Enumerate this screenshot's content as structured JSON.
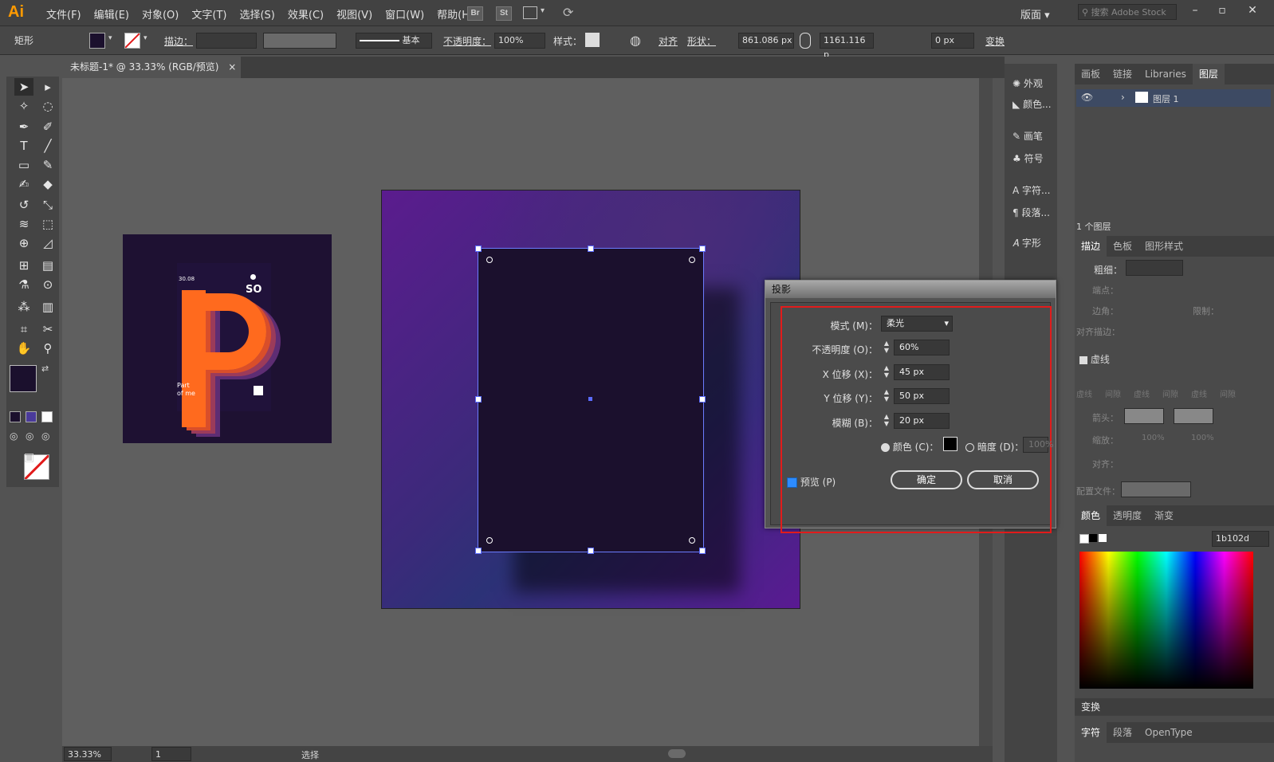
{
  "app": {
    "logo": "Ai"
  },
  "menu": [
    "文件(F)",
    "编辑(E)",
    "对象(O)",
    "文字(T)",
    "选择(S)",
    "效果(C)",
    "视图(V)",
    "窗口(W)",
    "帮助(H)"
  ],
  "bridge_labels": {
    "br": "Br",
    "st": "St"
  },
  "workspace": {
    "label": "版面",
    "search_placeholder": "搜索 Adobe Stock"
  },
  "control_bar": {
    "object_type": "矩形",
    "stroke_label": "描边：",
    "stroke_style": "基本",
    "opacity_label": "不透明度：",
    "opacity_value": "100%",
    "style_label": "样式：",
    "align_label": "对齐",
    "shape_label": "形状：",
    "width_value": "861.086 px",
    "height_value": "1161.116 p",
    "corner_value": "0 px",
    "transform_label": "变换"
  },
  "document": {
    "tab_title": "未标题-1* @ 33.33% (RGB/预览)",
    "close": "×"
  },
  "status": {
    "zoom": "33.33%",
    "page": "1",
    "mode": "选择"
  },
  "poster": {
    "date": "30.08",
    "so": "SO",
    "caption": "Part\nof me"
  },
  "mid_panel": [
    "外观",
    "颜色...",
    "画笔",
    "符号",
    "字符...",
    "段落...",
    "字形"
  ],
  "layers_panel": {
    "tabs": [
      "画板",
      "链接",
      "Libraries",
      "图层"
    ],
    "active_tab": "图层",
    "layer_name": "图层 1",
    "count": "1 个图层"
  },
  "stroke_panel": {
    "tabs": [
      "描边",
      "色板",
      "图形样式"
    ],
    "weight_label": "粗细：",
    "cap_label": "端点：",
    "corner_label": "边角：",
    "limit_label": "限制：",
    "align_label": "对齐描边：",
    "dashed_label": "虚线",
    "dash_gap": [
      "虚线",
      "间隙",
      "虚线",
      "间隙",
      "虚线",
      "间隙"
    ],
    "arrow_label": "箭头：",
    "scale_label": "缩放：",
    "scale_values": [
      "100%",
      "100%"
    ],
    "align2_label": "对齐：",
    "profile_label": "配置文件："
  },
  "color_panel": {
    "tabs": [
      "颜色",
      "透明度",
      "渐变"
    ],
    "hex": "1b102d"
  },
  "transform_panel": {
    "label": "变换"
  },
  "char_panel": {
    "tabs": [
      "字符",
      "段落",
      "OpenType"
    ]
  },
  "dialog": {
    "title": "投影",
    "mode_label": "模式 (M)：",
    "mode_value": "柔光",
    "opacity_label": "不透明度 (O)：",
    "opacity_value": "60%",
    "x_label": "X 位移 (X)：",
    "x_value": "45 px",
    "y_label": "Y 位移 (Y)：",
    "y_value": "50 px",
    "blur_label": "模糊 (B)：",
    "blur_value": "20 px",
    "color_label": "颜色 (C)：",
    "darkness_label": "暗度 (D)：",
    "darkness_value": "100%",
    "preview_label": "预览 (P)",
    "ok": "确定",
    "cancel": "取消"
  },
  "colors": {
    "fill": "#1b102d",
    "accent": "#e11b1b",
    "gradient_a": "#5a1a8a",
    "gradient_b": "#2b2a6e"
  }
}
